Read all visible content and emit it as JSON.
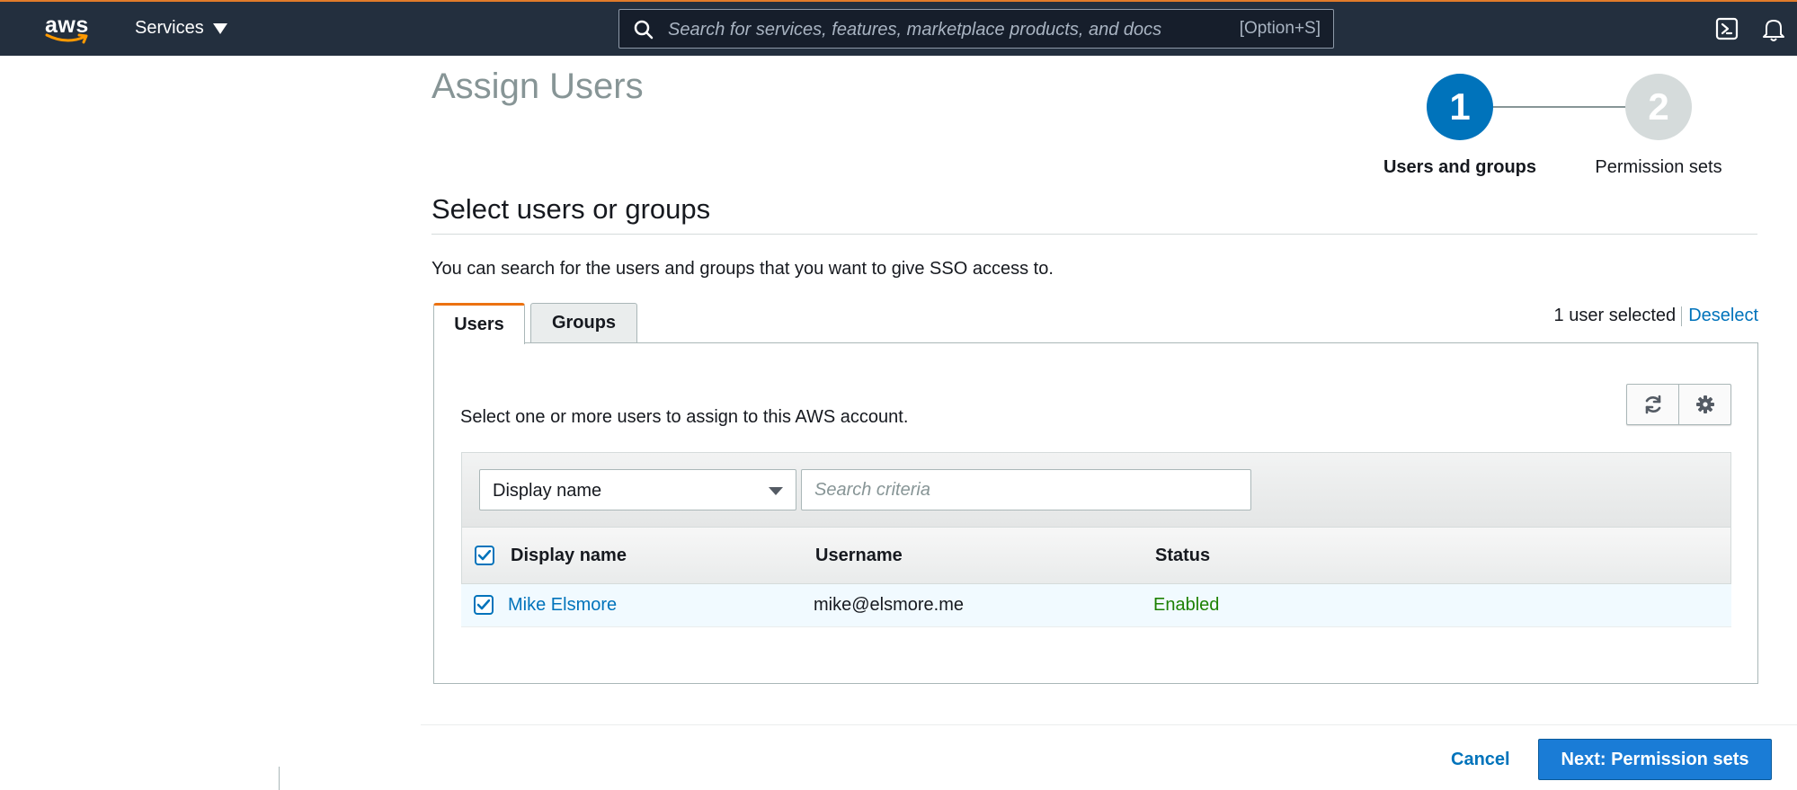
{
  "nav": {
    "logo_text": "aws",
    "services_label": "Services",
    "search_placeholder": "Search for services, features, marketplace products, and docs",
    "search_shortcut": "[Option+S]",
    "icons": [
      "cloudshell-icon",
      "bell-icon"
    ]
  },
  "page": {
    "title": "Assign Users",
    "steps": [
      {
        "number": "1",
        "label": "Users and groups",
        "active": true
      },
      {
        "number": "2",
        "label": "Permission sets",
        "active": false
      }
    ],
    "section_title": "Select users or groups",
    "description": "You can search for the users and groups that you want to give SSO access to."
  },
  "tabs": [
    {
      "label": "Users",
      "active": true
    },
    {
      "label": "Groups",
      "active": false
    }
  ],
  "selection": {
    "count_text": "1 user selected",
    "deselect_label": "Deselect"
  },
  "panel": {
    "description": "Select one or more users to assign to this AWS account.",
    "toolbar_icons": [
      "refresh-icon",
      "gear-icon"
    ],
    "filter": {
      "attribute": "Display name",
      "search_placeholder": "Search criteria"
    },
    "columns": [
      "Display name",
      "Username",
      "Status"
    ],
    "rows": [
      {
        "display_name": "Mike Elsmore",
        "username": "mike@elsmore.me",
        "status": "Enabled",
        "selected": true
      }
    ]
  },
  "footer": {
    "cancel_label": "Cancel",
    "next_label": "Next: Permission sets"
  },
  "colors": {
    "nav_bg": "#232f3e",
    "accent_orange": "#ec7211",
    "primary_blue": "#0073bb",
    "status_green": "#1d8102"
  }
}
